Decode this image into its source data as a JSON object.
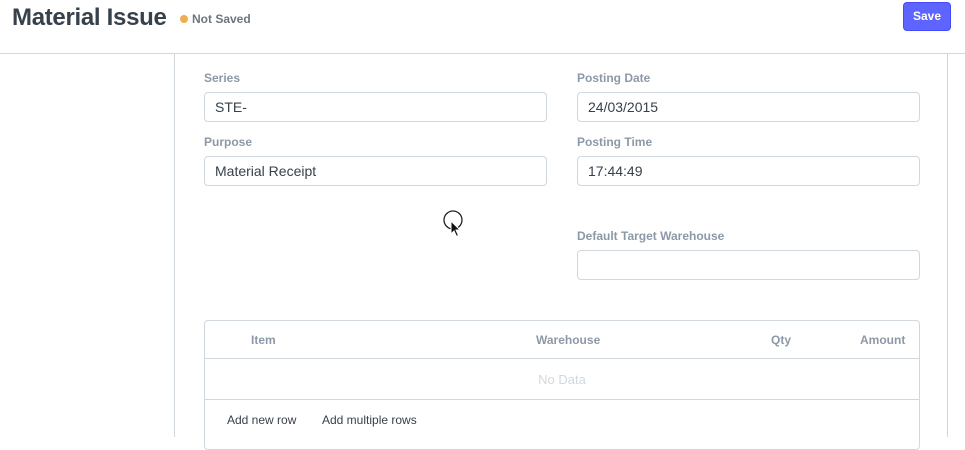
{
  "header": {
    "title": "Material Issue",
    "status": "Not Saved",
    "save_label": "Save",
    "status_color": "#f0ad4e",
    "accent_color": "#5e64ff"
  },
  "form": {
    "series": {
      "label": "Series",
      "value": "STE-"
    },
    "posting_date": {
      "label": "Posting Date",
      "value": "24/03/2015"
    },
    "purpose": {
      "label": "Purpose",
      "value": "Material Receipt"
    },
    "posting_time": {
      "label": "Posting Time",
      "value": "17:44:49"
    },
    "default_target_warehouse": {
      "label": "Default Target Warehouse",
      "value": ""
    }
  },
  "grid": {
    "columns": [
      "Item",
      "Warehouse",
      "Qty",
      "Amount"
    ],
    "empty_text": "No Data",
    "add_row_label": "Add new row",
    "add_multiple_label": "Add multiple rows"
  }
}
